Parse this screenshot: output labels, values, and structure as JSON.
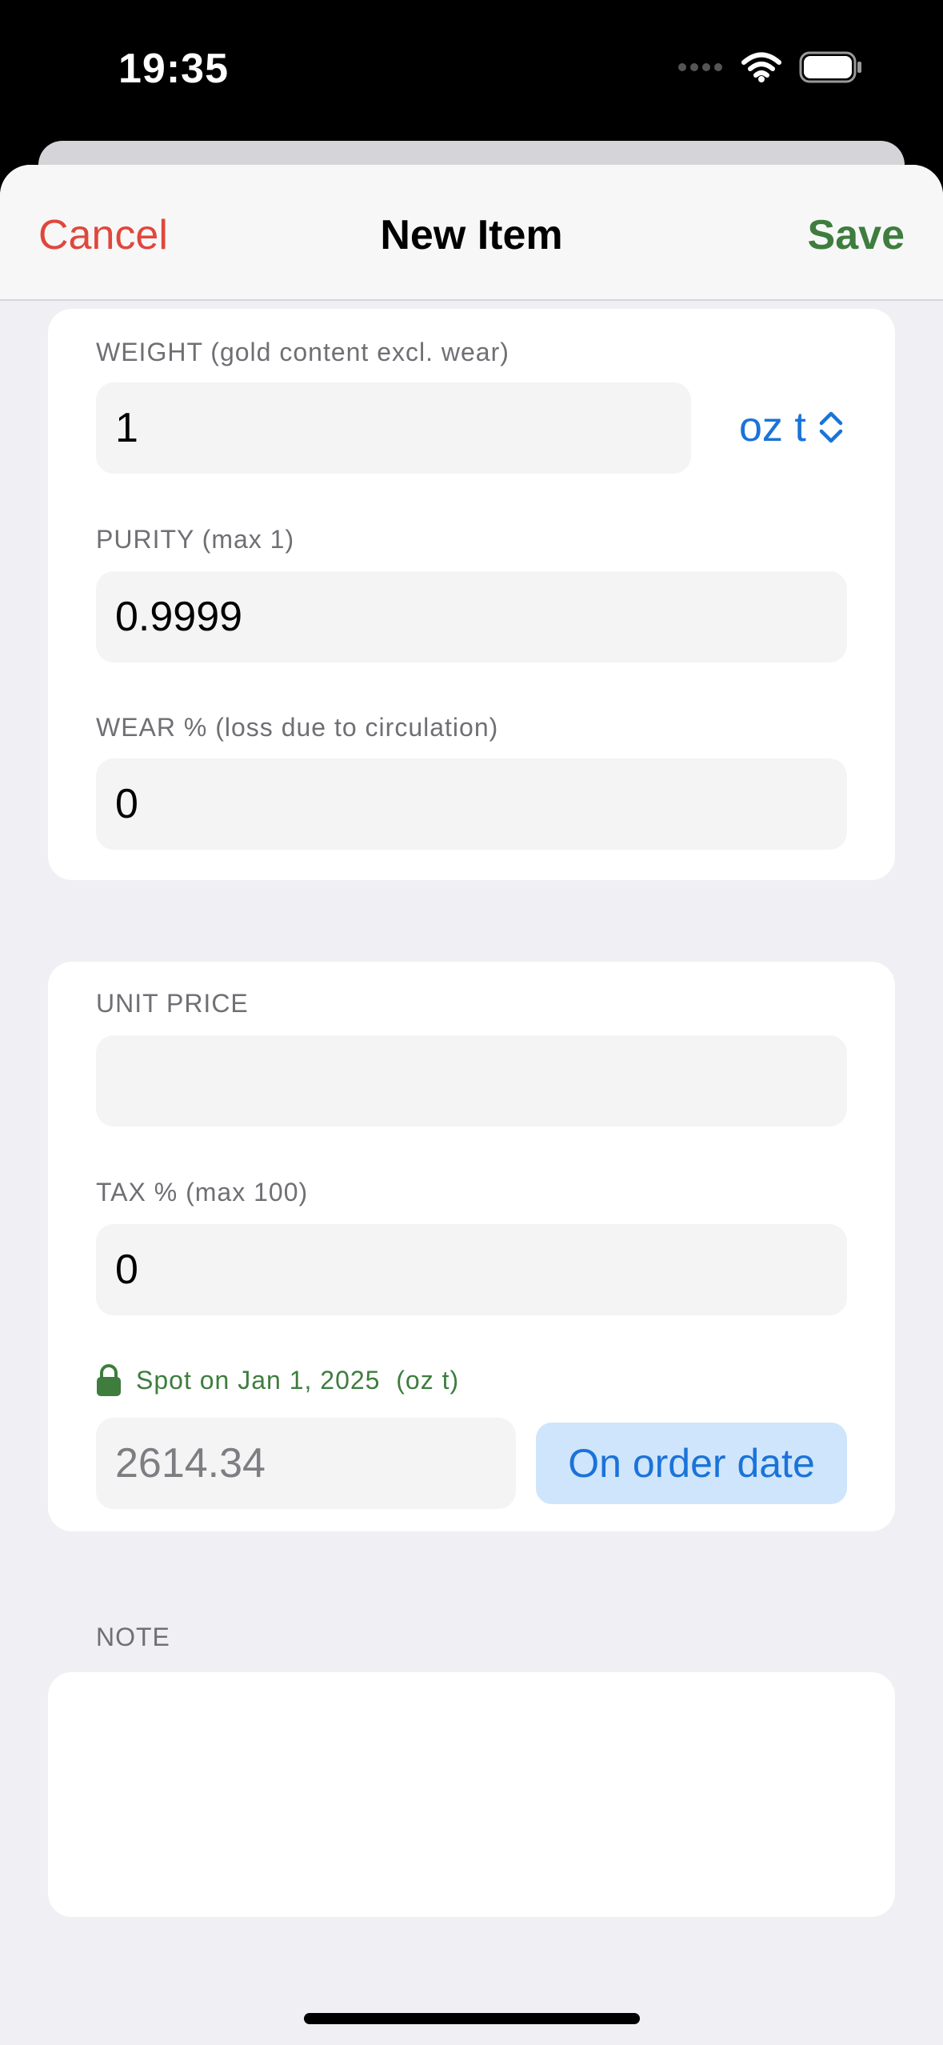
{
  "status_bar": {
    "time": "19:35"
  },
  "nav": {
    "cancel": "Cancel",
    "title": "New Item",
    "save": "Save"
  },
  "weight": {
    "label": "WEIGHT (gold content excl. wear)",
    "value": "1",
    "unit": "oz t"
  },
  "purity": {
    "label": "PURITY (max 1)",
    "value": "0.9999"
  },
  "wear": {
    "label": "WEAR % (loss due to circulation)",
    "value": "0"
  },
  "unit_price": {
    "label": "UNIT PRICE",
    "value": ""
  },
  "tax": {
    "label": "TAX % (max 100)",
    "value": "0"
  },
  "spot": {
    "label": "Spot on Jan 1, 2025  (oz t)",
    "value": "2614.34",
    "button": "On order date"
  },
  "note": {
    "label": "NOTE",
    "value": ""
  },
  "colors": {
    "cancel": "#e0473c",
    "save": "#3e7d3e",
    "accent": "#1a73d9",
    "spot": "#3e7d3e"
  },
  "icons": [
    "wifi-icon",
    "battery-icon",
    "signal-dots-icon",
    "chevron-up-down-icon",
    "lock-icon"
  ]
}
